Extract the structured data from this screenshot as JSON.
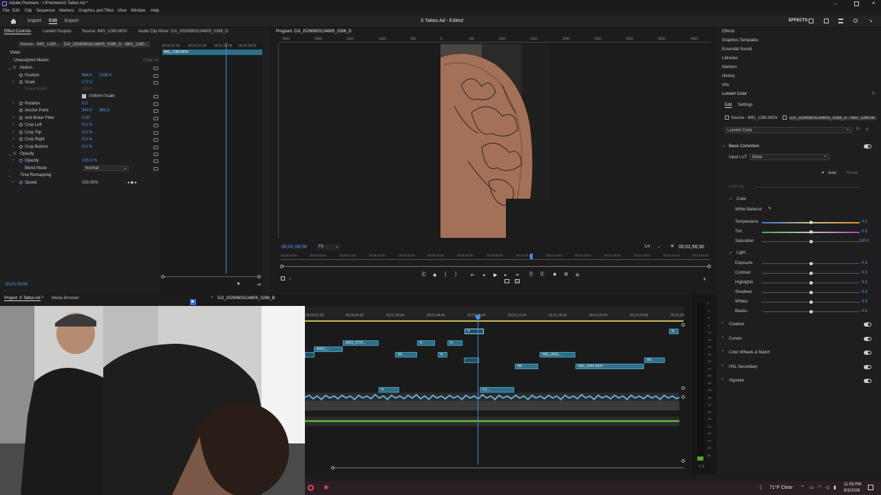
{
  "app": {
    "title": "Adobe Premiere - I:\\Premiere\\X Tattoo Ad *",
    "window_title": "X Tattoo Ad - Edited",
    "menus": [
      "File",
      "Edit",
      "Clip",
      "Sequence",
      "Markers",
      "Graphics and Titles",
      "View",
      "Window",
      "Help"
    ],
    "workspace_tabs": [
      "Import",
      "Edit",
      "Export"
    ],
    "effects_label": "EFFECTS"
  },
  "effect_controls": {
    "tabs": [
      "Effect Controls",
      "Lumetri Scopes",
      "Source: IMG_1280.MOV",
      "Audio Clip Mixer: DJI_20260803134805_0288_D"
    ],
    "source_path": "Source - IMG_1280...",
    "clip_path": "DJI_20260803134805_0288_D - IMG_1280...",
    "clip_name": "IMG_1280.MOV",
    "ruler_labels": [
      "00;01;07;24",
      "00;01;07;24",
      "00;01;08;04",
      "00;01;08;20"
    ],
    "video_label": "Video",
    "masks_label": "Unassigned Masks",
    "clear_all": "Clear all",
    "rows": [
      {
        "label": "Motion",
        "value": "",
        "value2": ""
      },
      {
        "label": "Position",
        "value": "864.0",
        "value2": "1536.0"
      },
      {
        "label": "Scale",
        "value": "172.0",
        "value2": ""
      },
      {
        "label": "Scale Width",
        "value": "100.0",
        "value2": ""
      },
      {
        "label": "Uniform Scale",
        "value": "",
        "value2": ""
      },
      {
        "label": "Rotation",
        "value": "0.0",
        "value2": ""
      },
      {
        "label": "Anchor Point",
        "value": "540.0",
        "value2": "960.0"
      },
      {
        "label": "Anti-flicker Filter",
        "value": "0.00",
        "value2": ""
      },
      {
        "label": "Crop Left",
        "value": "0.0 %",
        "value2": ""
      },
      {
        "label": "Crop Top",
        "value": "0.0 %",
        "value2": ""
      },
      {
        "label": "Crop Right",
        "value": "0.0 %",
        "value2": ""
      },
      {
        "label": "Crop Bottom",
        "value": "0.0 %",
        "value2": ""
      },
      {
        "label": "Opacity",
        "value": "",
        "value2": ""
      },
      {
        "label": "Opacity",
        "value": "100.0 %",
        "value2": ""
      },
      {
        "label": "Blend Mode",
        "value": "Normal",
        "value2": ""
      },
      {
        "label": "Time Remapping",
        "value": "",
        "value2": ""
      },
      {
        "label": "Speed",
        "value": "100.00%",
        "value2": ""
      }
    ],
    "timecode": "00;01;08;08"
  },
  "program": {
    "tab": "Program: DJI_20260803134805_0288_D",
    "timecode": "00;01;08;08",
    "fit": "Fit",
    "quality": "1/4",
    "duration": "00;01;56;30",
    "ruler_labels": [
      "2500",
      "2000",
      "1500",
      "1000",
      "500",
      "0",
      "500",
      "1000",
      "1500",
      "2000",
      "2500",
      "3000",
      "3500",
      "4000"
    ],
    "mini_ruler_labels": [
      "00;00;00;00",
      "00;00;08;00",
      "00;00;16;00",
      "00;00;24;00",
      "00;00;32;00",
      "00;00;40;00",
      "00;00;48;00",
      "00;00;56;00",
      "00;01;04;04",
      "00;01;12;04",
      "00;01;20;04",
      "00;01;28;04",
      "00;01;36;04",
      "00;01;44;04",
      "00;01;52;04"
    ]
  },
  "right_panel": {
    "items": [
      "Effects",
      "Graphics Templates",
      "Essential Sound",
      "Libraries",
      "Markers",
      "History",
      "Info"
    ],
    "lumetri": {
      "title": "Lumetri Color",
      "tabs": [
        "Edit",
        "Settings"
      ],
      "source": "Source - IMG_1280.MOV",
      "clip": "DJI_20260803134805_0288_D - IMG_1280.M...",
      "effect_select": "Lumetri Color",
      "basic_correction": "Basic Correction",
      "input_lut_label": "Input LUT",
      "input_lut_value": "None",
      "auto": "Auto",
      "reset": "Reset",
      "intensity_label": "Intensity",
      "color_label": "Color",
      "white_balance": "White Balance",
      "color_sliders": [
        {
          "label": "Temperature",
          "value": "0.0"
        },
        {
          "label": "Tint",
          "value": "0.0"
        },
        {
          "label": "Saturation",
          "value": "100.0"
        }
      ],
      "light_label": "Light",
      "light_sliders": [
        {
          "label": "Exposure",
          "value": "0.0"
        },
        {
          "label": "Contrast",
          "value": "0.0"
        },
        {
          "label": "Highlights",
          "value": "0.0"
        },
        {
          "label": "Shadows",
          "value": "0.0"
        },
        {
          "label": "Whites",
          "value": "0.0"
        },
        {
          "label": "Blacks",
          "value": "0.0"
        }
      ],
      "sections": [
        "Creative",
        "Curves",
        "Color Wheels & Match",
        "HSL Secondary",
        "Vignette"
      ]
    }
  },
  "project": {
    "tabs": [
      "Project: X Tattoo Ad",
      "Media Browser"
    ]
  },
  "timeline": {
    "tab": "DJI_20260803134805_0288_D",
    "ruler_labels": [
      "00;00;52;00",
      "00;00;56;00",
      "00;01;00;04",
      "00;01;04;04",
      "00;01;08;04",
      "00;01;12;04",
      "00;01;16;04",
      "00;01;20;04",
      "00;01;24;04",
      "00;01;28;"
    ],
    "clips": [
      "A053_0722...",
      "A053_...",
      "IM...",
      "IMG_0023...",
      "IM...",
      "IMG_5545.MOV",
      "IM...",
      "DJ..."
    ],
    "fx": "fx"
  },
  "meters": {
    "scale": [
      "0",
      "-3",
      "-6",
      "-9",
      "-12",
      "-15",
      "-18",
      "-21",
      "-24",
      "-27",
      "-30",
      "-33",
      "-36",
      "-39",
      "-42",
      "-45",
      "-48",
      "-51",
      "-54",
      "-57",
      "-60",
      "dB"
    ],
    "footer": "S S"
  },
  "taskbar": {
    "weather": "71°F  Clear",
    "time": "11:05 PM",
    "date": "8/3/2026"
  },
  "colors": {
    "accent": "#4f9cff",
    "playhead": "#4a8fd6",
    "clip": "#2d6f8a",
    "audio": "#5fb2d6",
    "green_audio": "#5aa33a"
  }
}
